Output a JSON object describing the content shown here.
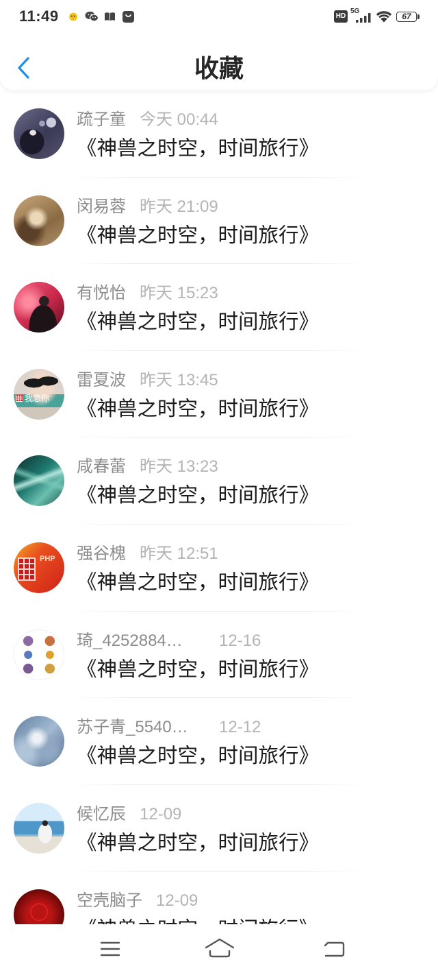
{
  "status_bar": {
    "time": "11:49",
    "notification_icons": [
      "yellow-bird-icon",
      "wechat-icon",
      "book-icon",
      "shopping-bag-icon"
    ],
    "hd_label": "HD",
    "network_label": "5G",
    "signal_icon": "signal-bars-icon",
    "wifi_icon": "wifi-icon",
    "battery_level": "67"
  },
  "header": {
    "back_icon": "chevron-left-icon",
    "title": "收藏"
  },
  "favorites": [
    {
      "name": "疏子童",
      "time": "今天 00:44",
      "title": "《神兽之时空，时间旅行》"
    },
    {
      "name": "闵易蓉",
      "time": "昨天 21:09",
      "title": "《神兽之时空，时间旅行》"
    },
    {
      "name": "有悦怡",
      "time": "昨天 15:23",
      "title": "《神兽之时空，时间旅行》"
    },
    {
      "name": "雷夏波",
      "time": "昨天 13:45",
      "title": "《神兽之时空，时间旅行》",
      "avatar_text": "我恋你"
    },
    {
      "name": "咸春蕾",
      "time": "昨天 13:23",
      "title": "《神兽之时空，时间旅行》"
    },
    {
      "name": "强谷槐",
      "time": "昨天 12:51",
      "title": "《神兽之时空，时间旅行》",
      "avatar_text": "PHP"
    },
    {
      "name": "琦_4252884…",
      "time": "12-16",
      "title": "《神兽之时空，时间旅行》"
    },
    {
      "name": "苏子青_5540…",
      "time": "12-12",
      "title": "《神兽之时空，时间旅行》"
    },
    {
      "name": "候忆辰",
      "time": "12-09",
      "title": "《神兽之时空，时间旅行》"
    },
    {
      "name": "空壳脑子",
      "time": "12-09",
      "title": "《神兽之时空，时间旅行》"
    }
  ],
  "bottom_nav": {
    "menu_icon": "menu-icon",
    "home_icon": "home-icon",
    "back_icon": "back-icon"
  },
  "colors": {
    "accent": "#1e8fe6",
    "name_text": "#8c8c8c",
    "time_text": "#b4b4b4",
    "title_text": "#1c1c1c"
  }
}
